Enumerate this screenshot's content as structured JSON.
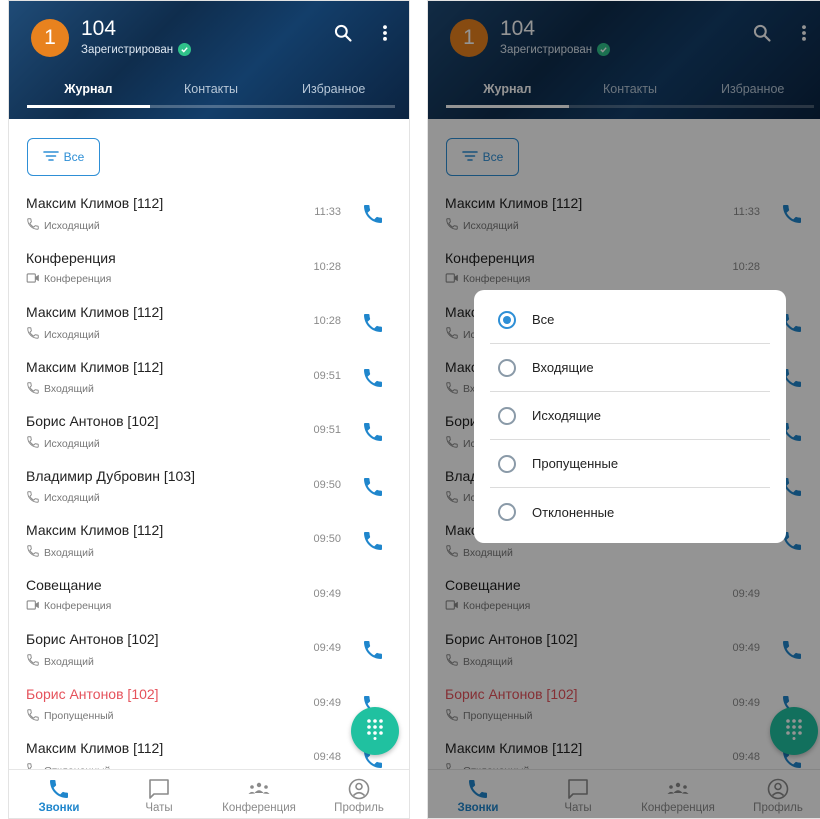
{
  "header": {
    "avatar_initial": "1",
    "extension": "104",
    "status": "Зарегистрирован",
    "tabs": [
      {
        "label": "Журнал",
        "active": true
      },
      {
        "label": "Контакты",
        "active": false
      },
      {
        "label": "Избранное",
        "active": false
      }
    ]
  },
  "filter": {
    "label": "Все"
  },
  "calls": [
    {
      "name": "Максим Климов [112]",
      "type": "Исходящий",
      "icon": "outgoing-call-icon",
      "time": "11:33",
      "callable": true,
      "missed": false
    },
    {
      "name": "Конференция",
      "type": "Конференция",
      "icon": "video-camera-icon",
      "time": "10:28",
      "callable": false,
      "missed": false
    },
    {
      "name": "Максим Климов [112]",
      "type": "Исходящий",
      "icon": "outgoing-call-icon",
      "time": "10:28",
      "callable": true,
      "missed": false
    },
    {
      "name": "Максим Климов [112]",
      "type": "Входящий",
      "icon": "incoming-call-icon",
      "time": "09:51",
      "callable": true,
      "missed": false
    },
    {
      "name": "Борис Антонов [102]",
      "type": "Исходящий",
      "icon": "outgoing-call-icon",
      "time": "09:51",
      "callable": true,
      "missed": false
    },
    {
      "name": "Владимир Дубровин [103]",
      "type": "Исходящий",
      "icon": "outgoing-call-icon",
      "time": "09:50",
      "callable": true,
      "missed": false
    },
    {
      "name": "Максим Климов [112]",
      "type": "Входящий",
      "icon": "incoming-call-icon",
      "time": "09:50",
      "callable": true,
      "missed": false
    },
    {
      "name": "Совещание",
      "type": "Конференция",
      "icon": "video-camera-icon",
      "time": "09:49",
      "callable": false,
      "missed": false
    },
    {
      "name": "Борис Антонов [102]",
      "type": "Входящий",
      "icon": "incoming-call-icon",
      "time": "09:49",
      "callable": true,
      "missed": false
    },
    {
      "name": "Борис Антонов [102]",
      "type": "Пропущенный",
      "icon": "missed-call-icon",
      "time": "09:49",
      "callable": true,
      "missed": true
    },
    {
      "name": "Максим Климов [112]",
      "type": "Отклоненный",
      "icon": "declined-call-icon",
      "time": "09:48",
      "callable": true,
      "missed": false
    }
  ],
  "bottom_nav": [
    {
      "label": "Звонки",
      "icon": "phone-icon",
      "active": true
    },
    {
      "label": "Чаты",
      "icon": "chat-icon",
      "active": false
    },
    {
      "label": "Конференция",
      "icon": "conference-icon",
      "active": false
    },
    {
      "label": "Профиль",
      "icon": "profile-icon",
      "active": false
    }
  ],
  "filter_dialog": {
    "selected": "Все",
    "options": [
      "Все",
      "Входящие",
      "Исходящие",
      "Пропущенные",
      "Отклоненные"
    ]
  },
  "colors": {
    "accent": "#2e8fd6",
    "call_icon": "#1f86cc",
    "missed": "#e5525b",
    "fab": "#20c1a0",
    "avatar": "#e8821e",
    "status_ok": "#2fc28a"
  }
}
